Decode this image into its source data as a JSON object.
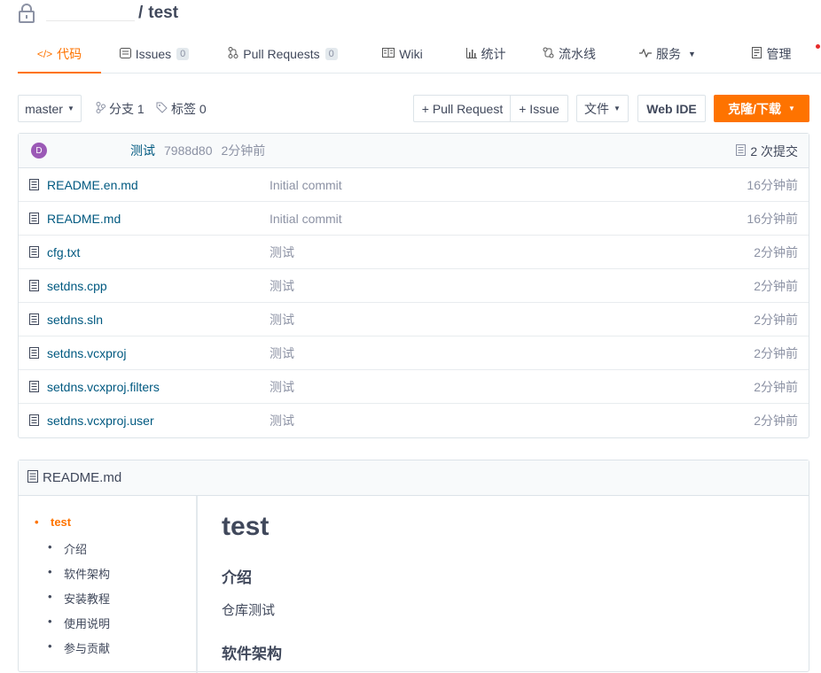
{
  "repo": {
    "name": "test",
    "separator": "/"
  },
  "tabs": [
    {
      "label": "代码",
      "icon": "code-icon",
      "active": true
    },
    {
      "label": "Issues",
      "icon": "issue-icon",
      "badge": "0"
    },
    {
      "label": "Pull Requests",
      "icon": "pull-request-icon",
      "badge": "0"
    },
    {
      "label": "Wiki",
      "icon": "book-icon"
    },
    {
      "label": "统计",
      "icon": "bar-chart-icon"
    },
    {
      "label": "流水线",
      "icon": "pipeline-icon"
    },
    {
      "label": "服务",
      "icon": "pulse-icon",
      "caret": true
    },
    {
      "label": "管理",
      "icon": "admin-icon",
      "dot": true
    }
  ],
  "toolbar": {
    "branch": "master",
    "branches_label": "分支 1",
    "tags_label": "标签 0",
    "pull_request": "+ Pull Request",
    "issue": "+ Issue",
    "file": "文件",
    "web_ide": "Web IDE",
    "clone": "克隆/下载"
  },
  "commit": {
    "avatar_letter": "D",
    "message": "测试",
    "hash": "7988d80",
    "time": "2分钟前",
    "count": "2 次提交"
  },
  "files": [
    {
      "name": "README.en.md",
      "message": "Initial commit",
      "time": "16分钟前"
    },
    {
      "name": "README.md",
      "message": "Initial commit",
      "time": "16分钟前"
    },
    {
      "name": "cfg.txt",
      "message": "测试",
      "time": "2分钟前"
    },
    {
      "name": "setdns.cpp",
      "message": "测试",
      "time": "2分钟前"
    },
    {
      "name": "setdns.sln",
      "message": "测试",
      "time": "2分钟前"
    },
    {
      "name": "setdns.vcxproj",
      "message": "测试",
      "time": "2分钟前"
    },
    {
      "name": "setdns.vcxproj.filters",
      "message": "测试",
      "time": "2分钟前"
    },
    {
      "name": "setdns.vcxproj.user",
      "message": "测试",
      "time": "2分钟前"
    }
  ],
  "readme": {
    "title": "README.md",
    "toc": [
      "test",
      "介绍",
      "软件架构",
      "安装教程",
      "使用说明",
      "参与贡献"
    ],
    "h1": "test",
    "h2_intro": "介绍",
    "intro_text": "仓库测试",
    "h2_arch": "软件架构"
  },
  "colors": {
    "accent": "#fe7300",
    "link": "#005980",
    "muted": "#8c92a4",
    "text": "#40485b",
    "avatar": "#9b59b6"
  }
}
